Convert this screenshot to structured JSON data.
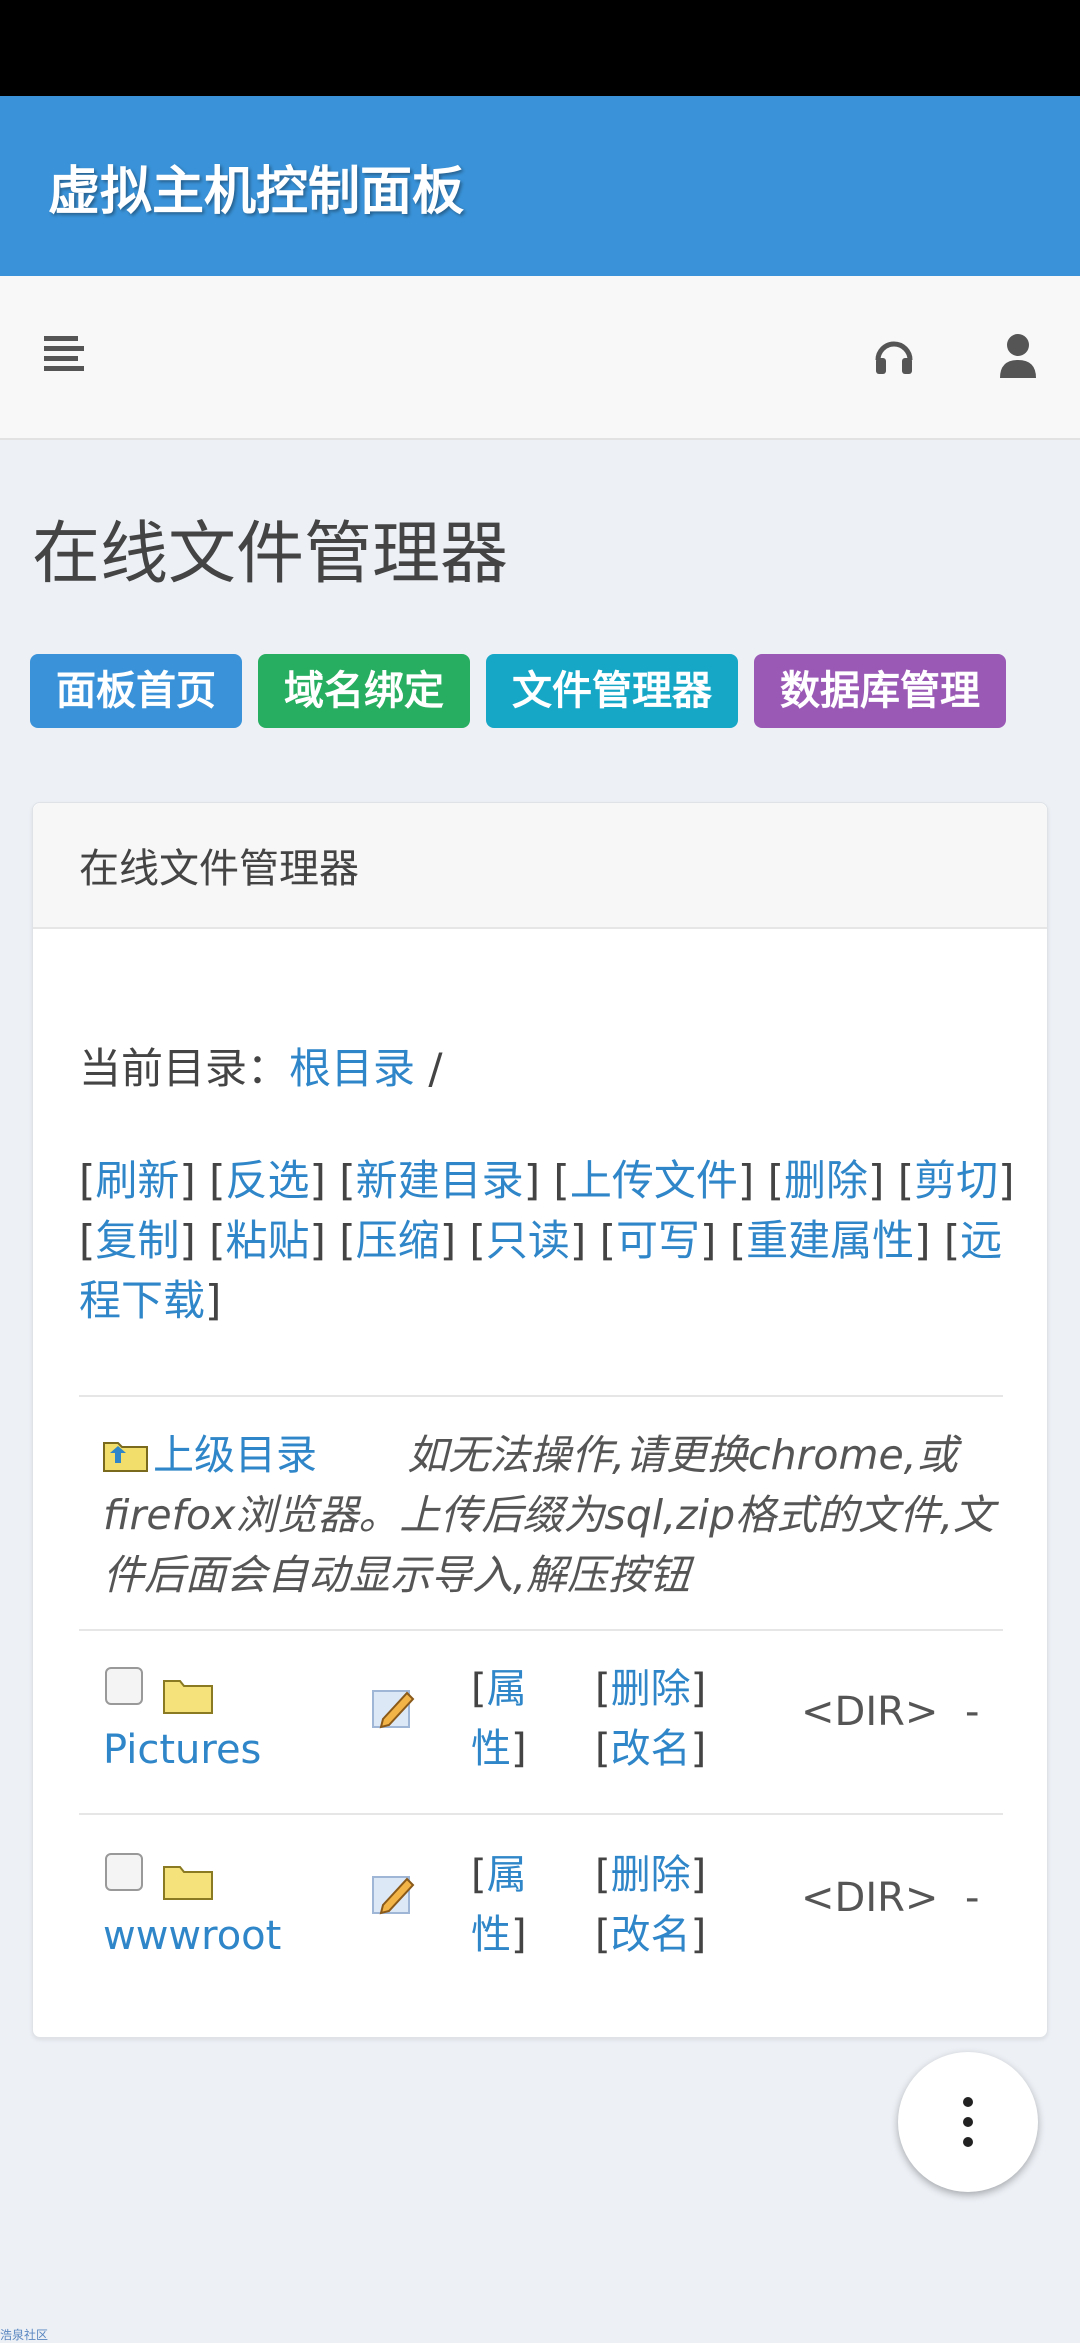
{
  "app": {
    "title": "虚拟主机控制面板"
  },
  "toolbar": {
    "icons": [
      "menu-icon",
      "headset-icon",
      "user-icon"
    ]
  },
  "page": {
    "title": "在线文件管理器"
  },
  "nav": [
    {
      "label": "面板首页",
      "color": "#3a93d9"
    },
    {
      "label": "域名绑定",
      "color": "#27ae60"
    },
    {
      "label": "文件管理器",
      "color": "#17a7c6"
    },
    {
      "label": "数据库管理",
      "color": "#9b59b6"
    }
  ],
  "panel": {
    "title": "在线文件管理器",
    "current_dir_label": "当前目录：",
    "current_dir_link": "根目录",
    "current_dir_suffix": " /",
    "actions": [
      "刷新",
      "反选",
      "新建目录",
      "上传文件",
      "删除",
      "剪切",
      "复制",
      "粘贴",
      "压缩",
      "只读",
      "可写",
      "重建属性",
      "远程下载"
    ],
    "up_link": "上级目录",
    "note": "如无法操作,请更换chrome,或firefox浏览器。上传后缀为sql,zip格式的文件,文件后面会自动显示导入,解压按钮",
    "files": [
      {
        "name": "Pictures",
        "prop": "属性",
        "delete": "删除",
        "rename": "改名",
        "type": "<DIR>",
        "size": "-"
      },
      {
        "name": "wwwroot",
        "prop": "属性",
        "delete": "删除",
        "rename": "改名",
        "type": "<DIR>",
        "size": "-"
      }
    ]
  },
  "watermark": "浩泉社区"
}
